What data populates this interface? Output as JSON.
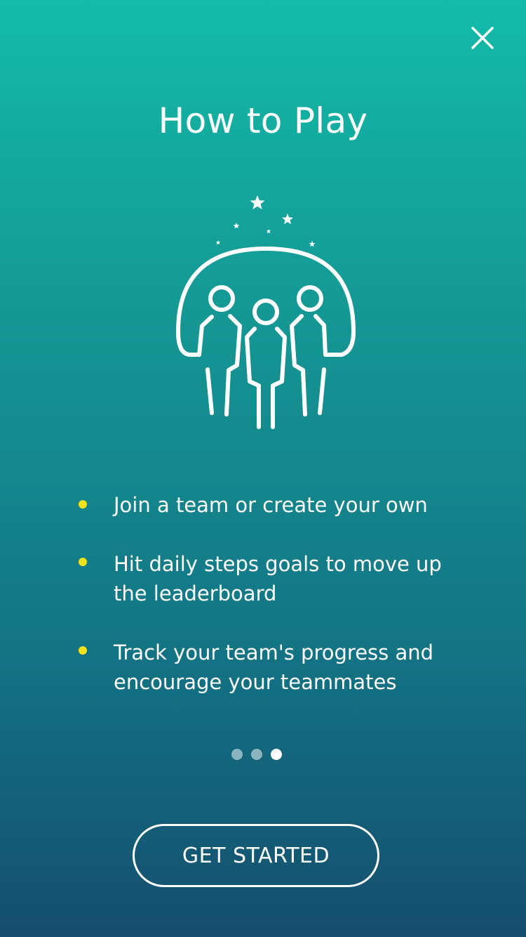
{
  "screen": {
    "title": "How to Play",
    "close_icon": "close-icon",
    "illustration_icon": "team-under-arch-with-stars-icon"
  },
  "bullets": [
    {
      "text": "Join a team or create your own"
    },
    {
      "text": "Hit daily steps goals to move up\nthe leaderboard"
    },
    {
      "text": "Track your team's progress and\nencourage your teammates"
    }
  ],
  "pagination": {
    "total": 3,
    "active_index": 2
  },
  "cta": {
    "label": "GET STARTED"
  },
  "colors": {
    "gradient_top": "#13bba8",
    "gradient_bottom": "#154e6e",
    "bullet": "#f2e21c",
    "dot_inactive": "#8ab4bf",
    "dot_active": "#ffffff",
    "text": "#ffffff"
  }
}
